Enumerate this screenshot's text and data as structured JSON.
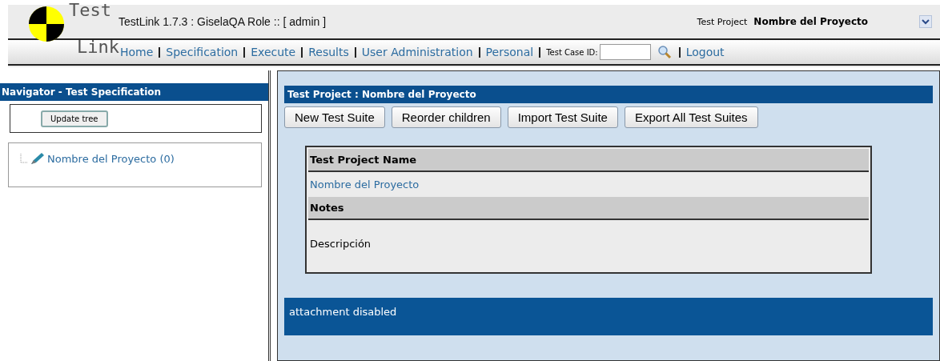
{
  "header": {
    "logo_top": "Test",
    "logo_bottom": "Link",
    "title": "TestLink 1.7.3 : GiselaQA Role :: [ admin ]",
    "project_label": "Test Project",
    "project_value": "Nombre del Proyecto"
  },
  "nav": {
    "links": [
      "Home",
      "Specification",
      "Execute",
      "Results",
      "User Administration",
      "Personal"
    ],
    "search_label": "Test Case ID:",
    "logout": "Logout"
  },
  "navigator": {
    "title": "Navigator - Test Specification",
    "button": "Update tree",
    "tree": [
      {
        "label": "Nombre del Proyecto (0)"
      }
    ]
  },
  "main": {
    "title": "Test Project : Nombre del Proyecto",
    "buttons": [
      "New Test Suite",
      "Reorder children",
      "Import Test Suite",
      "Export All Test Suites"
    ],
    "fields": [
      {
        "label": "Test Project Name",
        "value": "Nombre del Proyecto",
        "kind": "link"
      },
      {
        "label": "Notes",
        "value": "Descripción",
        "kind": "text"
      }
    ],
    "footer": "attachment disabled"
  }
}
